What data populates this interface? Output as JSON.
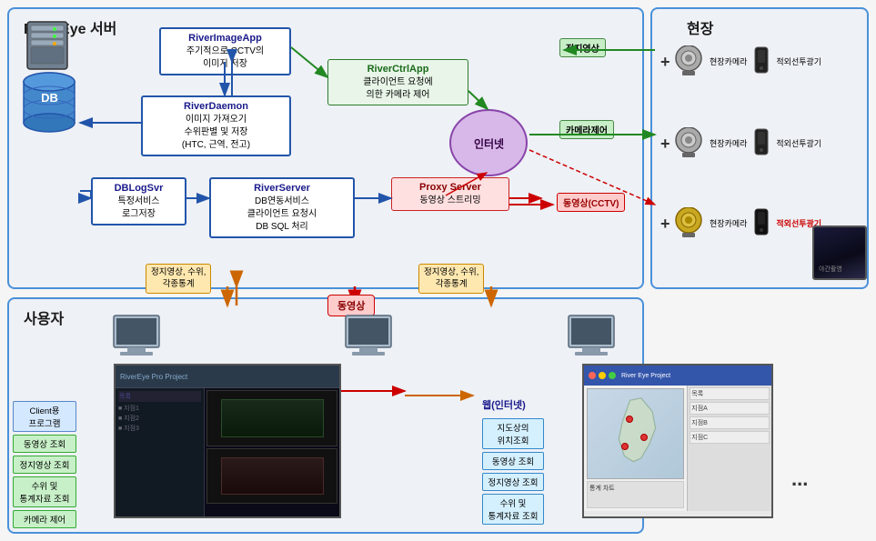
{
  "sections": {
    "server": {
      "title": "RiverEye 서버"
    },
    "field": {
      "title": "현장"
    },
    "user": {
      "title": "사용자"
    }
  },
  "components": {
    "riverImageApp": {
      "title": "RiverImageApp",
      "desc": "주기적으로 CCTV의\n이미지 저장"
    },
    "riverDaemon": {
      "title": "RiverDaemon",
      "desc1": "이미지 가져오기",
      "desc2": "수위판별 및 저장\n(HTC, 근역, 전고)"
    },
    "riverCtrlApp": {
      "title": "RiverCtrlApp",
      "desc": "클라이언트 요청에\n의한 카메라 제어"
    },
    "riverServer": {
      "title": "RiverServer",
      "desc1": "DB연동서비스",
      "desc2": "클라이언트 요청시\nDB SQL 처리"
    },
    "dbLogSvr": {
      "title": "DBLogSvr",
      "desc1": "특정서비스",
      "desc2": "로그저장"
    },
    "proxyServer": {
      "title": "Proxy Server",
      "desc": "동영상 스트리밍"
    },
    "db": {
      "label": "DB"
    },
    "internet": {
      "label": "인터넷"
    }
  },
  "labels": {
    "stillImage": "정지영상",
    "cameraControl": "카메라제어",
    "videoStream": "동영상(CCTV)",
    "video": "동영상",
    "statsData": "정지영상, 수위,\n각종통계",
    "statsData2": "정지영상, 수위,\n각종통계"
  },
  "field": {
    "cameras": [
      {
        "label": "현장카메라",
        "ir": "적외선투광기"
      },
      {
        "label": "현장카메라",
        "ir": "적외선투광기"
      },
      {
        "label": "현장카메라",
        "ir": "적외선투광기"
      }
    ]
  },
  "user": {
    "clientProgram": "Client용\n프로그램",
    "features": [
      "동영상 조회",
      "정지영상 조회",
      "수위 및\n통계자료 조회",
      "카메라 제어"
    ],
    "webFeatures": [
      "지도상의\n위치조회",
      "동영상 조회",
      "정지영상 조회",
      "수위 및\n통계자료 조회"
    ],
    "webTitle": "웹(인터넷)"
  },
  "ellipsis": "..."
}
